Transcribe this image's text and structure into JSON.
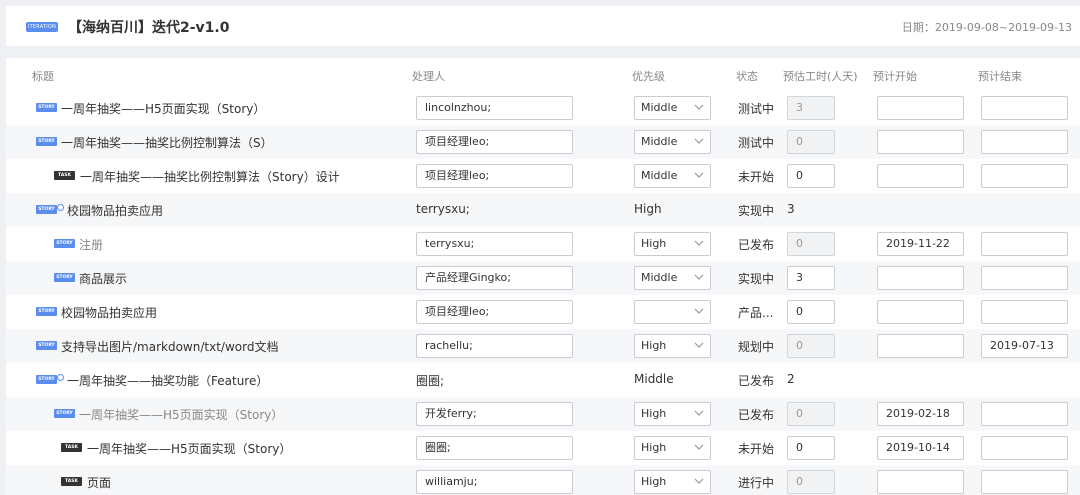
{
  "header": {
    "badge": "ITERATION",
    "title": "【海纳百川】迭代2-v1.0",
    "date": "日期：2019-09-08~2019-09-13"
  },
  "columns": {
    "title": "标题",
    "owner": "处理人",
    "priority": "优先级",
    "status": "状态",
    "estimate": "预估工时(人天)",
    "start": "预计开始",
    "end": "预计结束"
  },
  "badges": {
    "story": "STORY",
    "task": "TASK"
  },
  "rows": [
    {
      "type": "story",
      "title": "一周年抽奖——H5页面实现（Story）",
      "owner": "lincolnzhou;",
      "priority": "Middle",
      "status": "测试中",
      "estimate": "3",
      "start": "",
      "end": ""
    },
    {
      "type": "story",
      "title": "一周年抽奖——抽奖比例控制算法（S）",
      "owner": "项目经理leo;",
      "priority": "Middle",
      "status": "测试中",
      "estimate": "0",
      "start": "",
      "end": ""
    },
    {
      "type": "task",
      "title": "一周年抽奖——抽奖比例控制算法（Story）设计",
      "owner": "项目经理leo;",
      "priority": "Middle",
      "status": "未开始",
      "estimate": "0",
      "start": "",
      "end": ""
    },
    {
      "type": "story",
      "title": "校园物品拍卖应用",
      "owner": "terrysxu;",
      "priority": "High",
      "status": "实现中",
      "estimate": "3",
      "start": "",
      "end": ""
    },
    {
      "type": "story",
      "title": "注册",
      "owner": "terrysxu;",
      "priority": "High",
      "status": "已发布",
      "estimate": "0",
      "start": "2019-11-22",
      "end": ""
    },
    {
      "type": "story",
      "title": "商品展示",
      "owner": "产品经理Gingko;",
      "priority": "Middle",
      "status": "实现中",
      "estimate": "3",
      "start": "",
      "end": ""
    },
    {
      "type": "story",
      "title": "校园物品拍卖应用",
      "owner": "项目经理leo;",
      "priority": "",
      "status": "产品...",
      "estimate": "0",
      "start": "",
      "end": ""
    },
    {
      "type": "story",
      "title": "支持导出图片/markdown/txt/word文档",
      "owner": "rachellu;",
      "priority": "High",
      "status": "规划中",
      "estimate": "0",
      "start": "",
      "end": "2019-07-13"
    },
    {
      "type": "story",
      "title": "一周年抽奖——抽奖功能（Feature）",
      "owner": "圈圈;",
      "priority": "Middle",
      "status": "已发布",
      "estimate": "2",
      "start": "",
      "end": ""
    },
    {
      "type": "story",
      "title": "一周年抽奖——H5页面实现（Story）",
      "owner": "开发ferry;",
      "priority": "High",
      "status": "已发布",
      "estimate": "0",
      "start": "2019-02-18",
      "end": ""
    },
    {
      "type": "task",
      "title": "一周年抽奖——H5页面实现（Story）",
      "owner": "圈圈;",
      "priority": "High",
      "status": "未开始",
      "estimate": "0",
      "start": "2019-10-14",
      "end": ""
    },
    {
      "type": "task",
      "title": "页面",
      "owner": "williamju;",
      "priority": "High",
      "status": "进行中",
      "estimate": "0",
      "start": "",
      "end": ""
    }
  ]
}
